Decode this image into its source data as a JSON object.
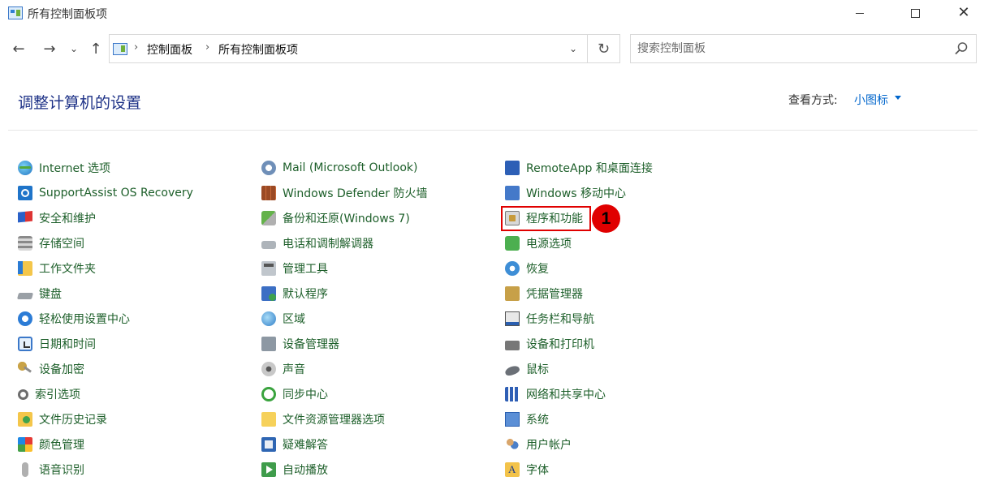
{
  "window": {
    "title": "所有控制面板项"
  },
  "address": {
    "crumbs": [
      "控制面板",
      "所有控制面板项"
    ],
    "search_placeholder": "搜索控制面板"
  },
  "header": {
    "title": "调整计算机的设置",
    "view_label": "查看方式:",
    "view_value": "小图标"
  },
  "columns": [
    {
      "items": [
        {
          "label": "Internet 选项",
          "icon": "internet-options-icon"
        },
        {
          "label": "SupportAssist OS Recovery",
          "icon": "supportassist-icon"
        },
        {
          "label": "安全和维护",
          "icon": "security-flag-icon"
        },
        {
          "label": "存储空间",
          "icon": "storage-spaces-icon"
        },
        {
          "label": "工作文件夹",
          "icon": "work-folders-icon"
        },
        {
          "label": "键盘",
          "icon": "keyboard-icon"
        },
        {
          "label": "轻松使用设置中心",
          "icon": "ease-of-access-icon"
        },
        {
          "label": "日期和时间",
          "icon": "date-time-icon"
        },
        {
          "label": "设备加密",
          "icon": "device-encryption-icon"
        },
        {
          "label": "索引选项",
          "icon": "indexing-options-icon"
        },
        {
          "label": "文件历史记录",
          "icon": "file-history-icon"
        },
        {
          "label": "颜色管理",
          "icon": "color-management-icon"
        },
        {
          "label": "语音识别",
          "icon": "speech-recognition-icon"
        }
      ]
    },
    {
      "items": [
        {
          "label": "Mail (Microsoft Outlook)",
          "icon": "mail-icon"
        },
        {
          "label": "Windows Defender 防火墙",
          "icon": "firewall-icon"
        },
        {
          "label": "备份和还原(Windows 7)",
          "icon": "backup-restore-icon"
        },
        {
          "label": "电话和调制解调器",
          "icon": "phone-modem-icon"
        },
        {
          "label": "管理工具",
          "icon": "admin-tools-icon"
        },
        {
          "label": "默认程序",
          "icon": "default-programs-icon"
        },
        {
          "label": "区域",
          "icon": "region-icon"
        },
        {
          "label": "设备管理器",
          "icon": "device-manager-icon"
        },
        {
          "label": "声音",
          "icon": "sound-icon"
        },
        {
          "label": "同步中心",
          "icon": "sync-center-icon"
        },
        {
          "label": "文件资源管理器选项",
          "icon": "explorer-options-icon"
        },
        {
          "label": "疑难解答",
          "icon": "troubleshooting-icon"
        },
        {
          "label": "自动播放",
          "icon": "autoplay-icon"
        }
      ]
    },
    {
      "items": [
        {
          "label": "RemoteApp 和桌面连接",
          "icon": "remoteapp-icon"
        },
        {
          "label": "Windows 移动中心",
          "icon": "mobility-center-icon"
        },
        {
          "label": "程序和功能",
          "icon": "programs-features-icon"
        },
        {
          "label": "电源选项",
          "icon": "power-options-icon"
        },
        {
          "label": "恢复",
          "icon": "recovery-icon"
        },
        {
          "label": "凭据管理器",
          "icon": "credential-manager-icon"
        },
        {
          "label": "任务栏和导航",
          "icon": "taskbar-navigation-icon"
        },
        {
          "label": "设备和打印机",
          "icon": "devices-printers-icon"
        },
        {
          "label": "鼠标",
          "icon": "mouse-icon"
        },
        {
          "label": "网络和共享中心",
          "icon": "network-sharing-icon"
        },
        {
          "label": "系统",
          "icon": "system-icon"
        },
        {
          "label": "用户帐户",
          "icon": "user-accounts-icon"
        },
        {
          "label": "字体",
          "icon": "fonts-icon"
        }
      ]
    }
  ],
  "annotation": {
    "badge": "1"
  },
  "colors": {
    "link_green": "#1d5f2a",
    "title_blue": "#1e3287",
    "accent_blue": "#0066cc",
    "highlight_red": "#e00000"
  }
}
